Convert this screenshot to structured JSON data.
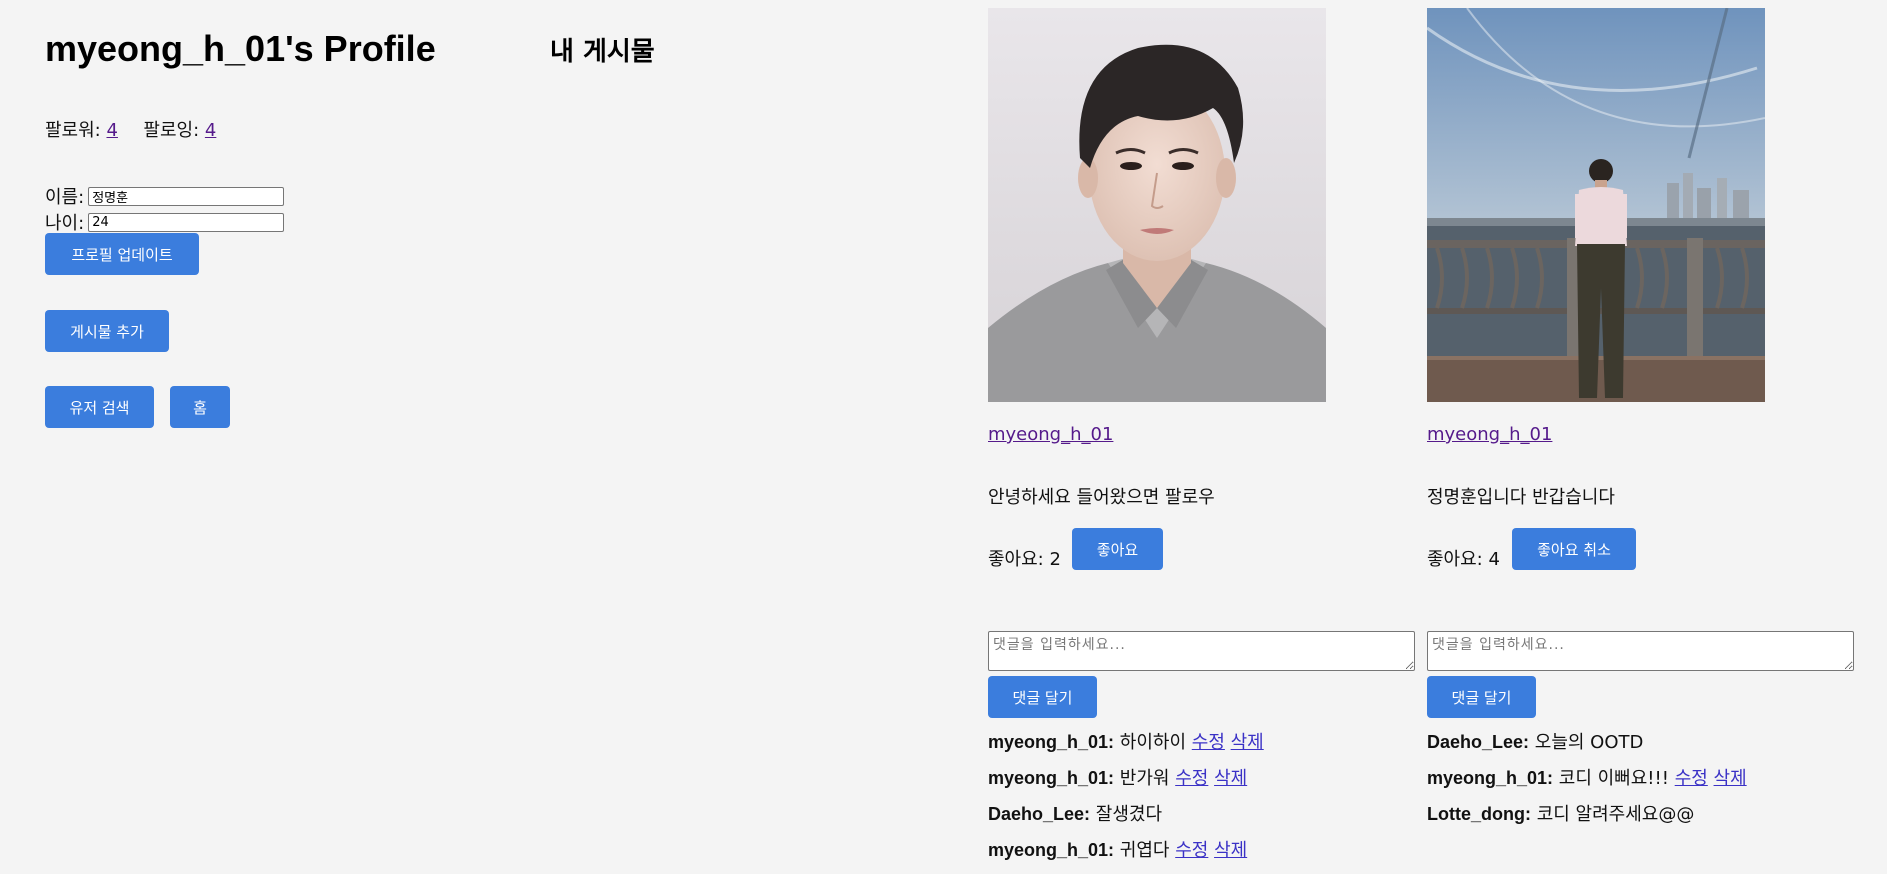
{
  "profile": {
    "title": "myeong_h_01's Profile",
    "followers_label": "팔로워:",
    "followers_count": "4",
    "following_label": "팔로잉:",
    "following_count": "4",
    "name_label": "이름:",
    "name_value": "정명훈",
    "age_label": "나이:",
    "age_value": "24",
    "update_button": "프로필 업데이트",
    "add_post_button": "게시물 추가",
    "user_search_button": "유저 검색",
    "home_button": "홈"
  },
  "posts_section": {
    "title": "내 게시물"
  },
  "colors": {
    "accent": "#3b7ddd",
    "background": "#f4f4f4",
    "visited_link": "#551a8b",
    "link": "#3b32c6"
  },
  "posts": [
    {
      "author": "myeong_h_01",
      "caption": "안녕하세요 들어왔으면 팔로우",
      "likes_label": "좋아요:",
      "likes_count": "2",
      "like_button": "좋아요",
      "comment_placeholder": "댓글을 입력하세요...",
      "comment_button": "댓글 달기",
      "comments": [
        {
          "user": "myeong_h_01:",
          "text": "하이하이",
          "edit": "수정",
          "delete": "삭제"
        },
        {
          "user": "myeong_h_01:",
          "text": "반가워",
          "edit": "수정",
          "delete": "삭제"
        },
        {
          "user": "Daeho_Lee:",
          "text": "잘생겼다"
        },
        {
          "user": "myeong_h_01:",
          "text": "귀엽다",
          "edit": "수정",
          "delete": "삭제"
        }
      ]
    },
    {
      "author": "myeong_h_01",
      "caption": "정명훈입니다 반갑습니다",
      "likes_label": "좋아요:",
      "likes_count": "4",
      "like_button": "좋아요 취소",
      "comment_placeholder": "댓글을 입력하세요...",
      "comment_button": "댓글 달기",
      "comments": [
        {
          "user": "Daeho_Lee:",
          "text": "오늘의 OOTD"
        },
        {
          "user": "myeong_h_01:",
          "text": "코디 이뻐요!!!",
          "edit": "수정",
          "delete": "삭제"
        },
        {
          "user": "Lotte_dong:",
          "text": "코디 알려주세요@@"
        }
      ]
    }
  ]
}
